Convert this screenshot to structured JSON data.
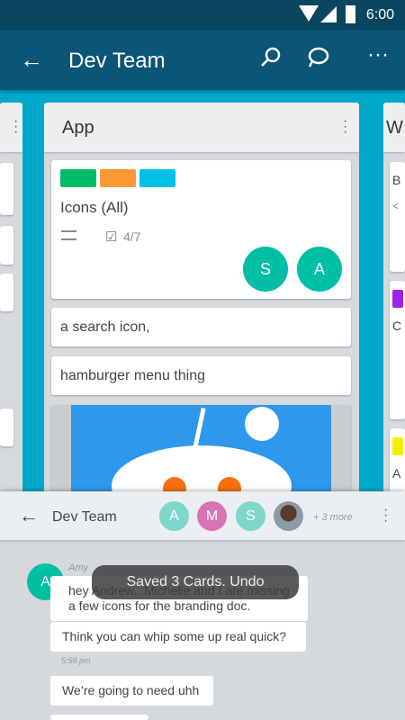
{
  "status_bar": {
    "time": "6:00"
  },
  "app_bar": {
    "title": "Dev Team"
  },
  "board": {
    "columns": [
      {
        "name": "App",
        "cards": [
          {
            "title": "Icons (All)",
            "labels": [
              "#00bb6a",
              "#fb9935",
              "#00c2e3"
            ],
            "checklist": "4/7",
            "members": [
              "S",
              "A"
            ]
          },
          {
            "title": "a search icon,"
          },
          {
            "title": "hamburger menu thing"
          }
        ]
      },
      {
        "name": "W",
        "cards": [
          {
            "title": "B",
            "sub": "<"
          },
          {
            "title": "C",
            "label": "#a020f0"
          },
          {
            "title": "A",
            "label": "#f7ee00"
          }
        ]
      }
    ]
  },
  "chat": {
    "title": "Dev Team",
    "members": [
      {
        "initial": "A",
        "color": "#7fd6cb"
      },
      {
        "initial": "M",
        "color": "#d873b5"
      },
      {
        "initial": "S",
        "color": "#7fd6cb"
      }
    ],
    "more": "+ 3 more",
    "messages": [
      {
        "author": "Amy",
        "author_initial": "A",
        "text": "hey Andrew.. Michelle and I are missing a few icons for the branding doc."
      },
      {
        "text": "Think you can whip some up real quick?",
        "time": "5:58 pm"
      },
      {
        "text": "We’re going to need uhh"
      }
    ]
  },
  "toast": {
    "text": "Saved 3 Cards. Undo"
  }
}
